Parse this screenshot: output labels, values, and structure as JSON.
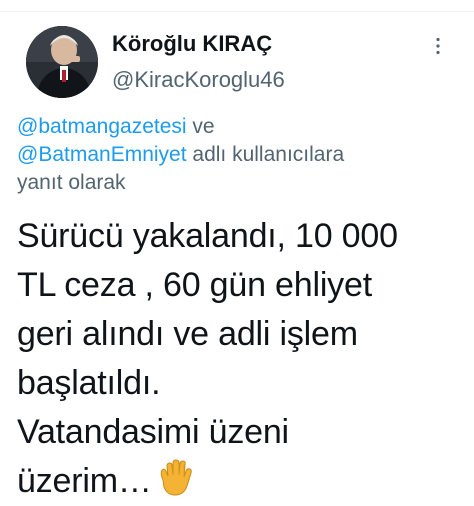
{
  "author": {
    "display_name": "Köroğlu KIRAÇ",
    "handle": "@KiracKoroglu46"
  },
  "reply_context": {
    "mention_1": "@batmangazetesi",
    "joiner": " ve",
    "mention_2": "@BatmanEmniyet",
    "suffix": " adlı kullanıcılara",
    "line_3": "yanıt olarak"
  },
  "tweet": {
    "lines": [
      "Sürücü yakalandı, 10 000",
      "TL ceza , 60 gün ehliyet",
      "geri alındı ve adli işlem",
      "başlatıldı.",
      "Vatandasimi üzeni",
      "üzerim…"
    ],
    "emoji": "raised-hand-emoji"
  },
  "icons": {
    "more": "more-options-icon",
    "emoji_color": "#f5b335",
    "mention_color": "#1d9bf0",
    "secondary_text_color": "#536471"
  }
}
